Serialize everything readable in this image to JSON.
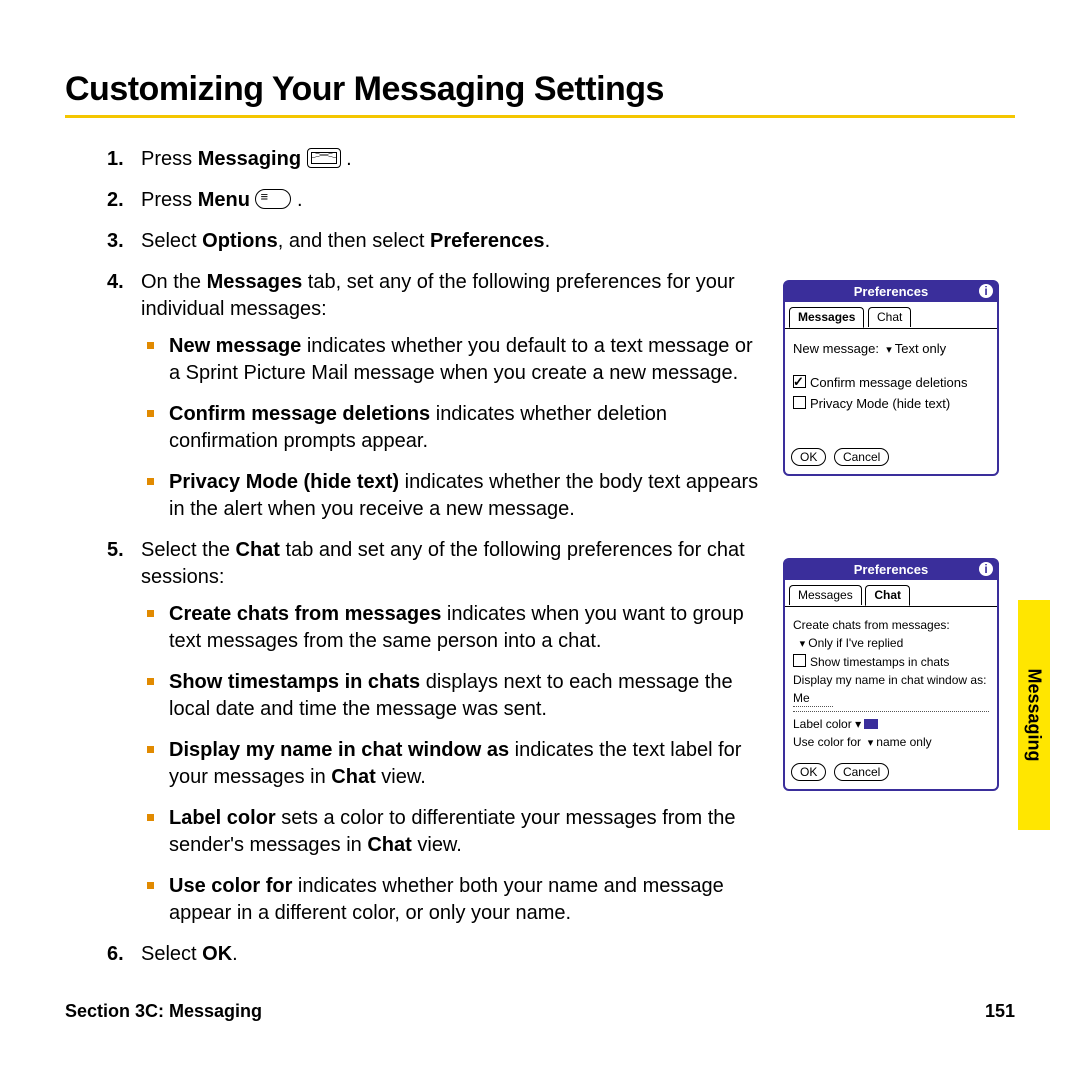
{
  "title": "Customizing Your Messaging Settings",
  "steps": {
    "s1": {
      "num": "1.",
      "prefix": "Press ",
      "bold": "Messaging",
      "suffix": " "
    },
    "s2": {
      "num": "2.",
      "prefix": "Press ",
      "bold": "Menu",
      "suffix": " "
    },
    "s3": {
      "num": "3.",
      "a": "Select ",
      "b1": "Options",
      "b": ", and then select ",
      "b2": "Preferences",
      "c": "."
    },
    "s4": {
      "num": "4.",
      "a": "On the ",
      "b1": "Messages",
      "b": " tab, set any of the following preferences for your individual messages:"
    },
    "s4_items": {
      "i1": {
        "b": "New message",
        "t": " indicates whether you default to a text message or a Sprint Picture Mail message when you create a new message."
      },
      "i2": {
        "b": "Confirm message deletions",
        "t": " indicates whether deletion confirmation prompts appear."
      },
      "i3": {
        "b": "Privacy Mode (hide text)",
        "t": " indicates whether the body text appears in the alert when you receive a new message."
      }
    },
    "s5": {
      "num": "5.",
      "a": "Select the ",
      "b1": "Chat",
      "b": " tab and set any of the following preferences for chat sessions:"
    },
    "s5_items": {
      "i1": {
        "b": "Create chats from messages",
        "t": " indicates when you want to group text messages from the same person into a chat."
      },
      "i2": {
        "b": "Show timestamps in chats",
        "t": " displays next to each message the local date and time the message was sent."
      },
      "i3": {
        "b": "Display my name in chat window as",
        "t": " indicates the text label for your messages in ",
        "b2": "Chat",
        "t2": " view."
      },
      "i4": {
        "b": "Label color",
        "t": " sets a color to differentiate your messages from the sender's messages in ",
        "b2": "Chat",
        "t2": " view."
      },
      "i5": {
        "b": "Use color for",
        "t": " indicates whether both your name and message appear in a different color, or only your name."
      }
    },
    "s6": {
      "num": "6.",
      "a": "Select ",
      "b1": "OK",
      "b": "."
    }
  },
  "panel1": {
    "title": "Preferences",
    "tabs": {
      "a": "Messages",
      "b": "Chat"
    },
    "newmsg_label": "New message:",
    "newmsg_value": "Text only",
    "confirm": "Confirm message deletions",
    "privacy": "Privacy Mode (hide text)",
    "ok": "OK",
    "cancel": "Cancel"
  },
  "panel2": {
    "title": "Preferences",
    "tabs": {
      "a": "Messages",
      "b": "Chat"
    },
    "create": "Create chats from messages:",
    "create_val": "Only if I've replied",
    "show_ts": "Show timestamps in chats",
    "display_name": "Display my name in chat window as:",
    "me": "Me",
    "label_color": "Label color",
    "use_color": "Use color for",
    "use_color_val": "name only",
    "ok": "OK",
    "cancel": "Cancel"
  },
  "footer": {
    "section": "Section 3C: Messaging",
    "page": "151"
  },
  "sidetab": "Messaging"
}
